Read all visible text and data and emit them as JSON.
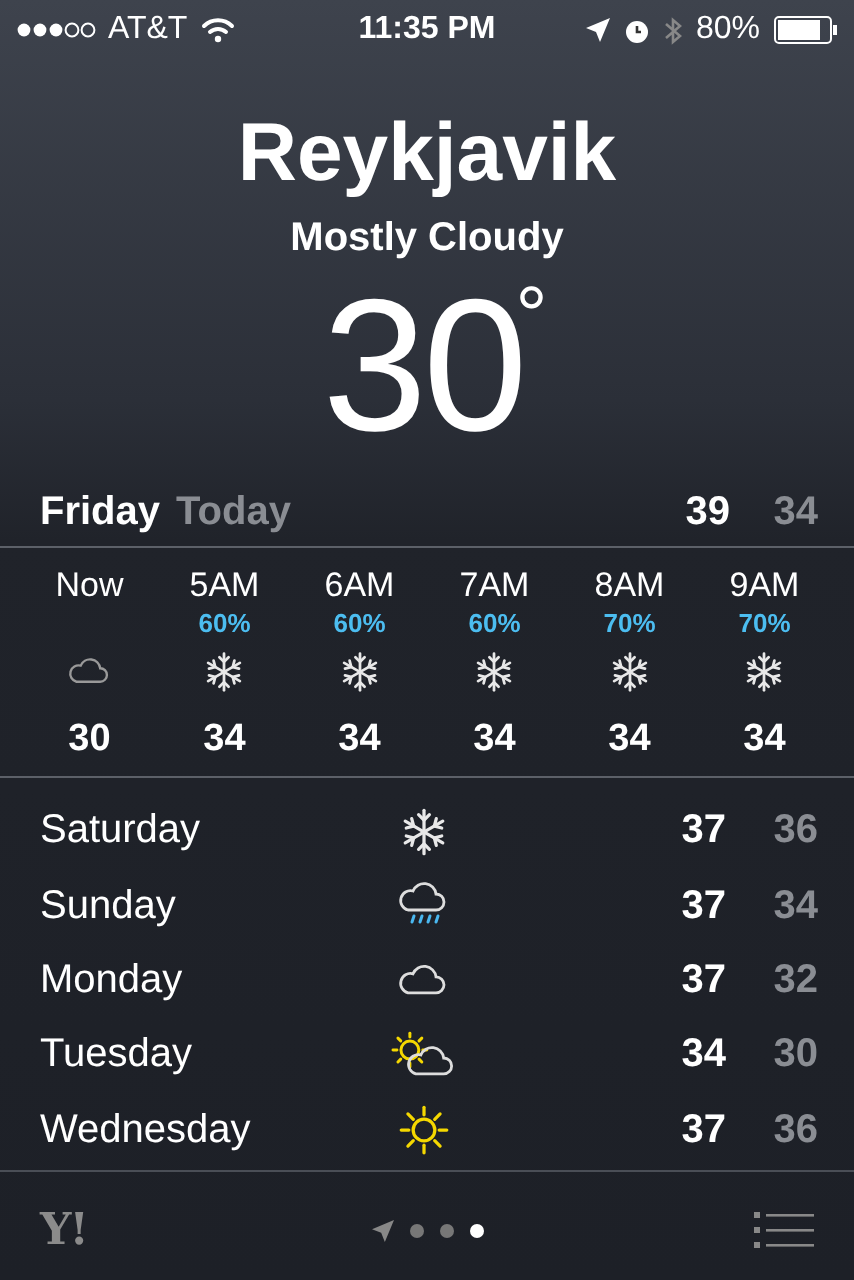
{
  "status_bar": {
    "carrier": "AT&T",
    "time": "11:35 PM",
    "battery": "80%"
  },
  "location": {
    "city": "Reykjavik",
    "condition": "Mostly Cloudy",
    "temperature": "30",
    "degree": "°"
  },
  "today": {
    "day": "Friday",
    "label": "Today",
    "high": "39",
    "low": "34"
  },
  "hourly": [
    {
      "time": "Now",
      "kind": "cloud",
      "temp": "30"
    },
    {
      "time": "5AM",
      "precip": "60%",
      "kind": "snow",
      "temp": "34"
    },
    {
      "time": "6AM",
      "precip": "60%",
      "kind": "snow",
      "temp": "34"
    },
    {
      "time": "7AM",
      "precip": "60%",
      "kind": "snow",
      "temp": "34"
    },
    {
      "time": "8AM",
      "precip": "70%",
      "kind": "snow",
      "temp": "34"
    },
    {
      "time": "9AM",
      "precip": "70%",
      "kind": "snow",
      "temp": "34"
    }
  ],
  "daily": [
    {
      "day": "Saturday",
      "kind": "snow",
      "high": "37",
      "low": "36"
    },
    {
      "day": "Sunday",
      "kind": "rain",
      "high": "37",
      "low": "34"
    },
    {
      "day": "Monday",
      "kind": "cloud",
      "high": "37",
      "low": "32"
    },
    {
      "day": "Tuesday",
      "kind": "suncloud",
      "high": "34",
      "low": "30"
    },
    {
      "day": "Wednesday",
      "kind": "sunny",
      "high": "37",
      "low": "36"
    }
  ],
  "footer": {
    "logo": "Y!",
    "pages": [
      {
        "selected": false
      },
      {
        "selected": false
      },
      {
        "selected": true
      }
    ]
  }
}
